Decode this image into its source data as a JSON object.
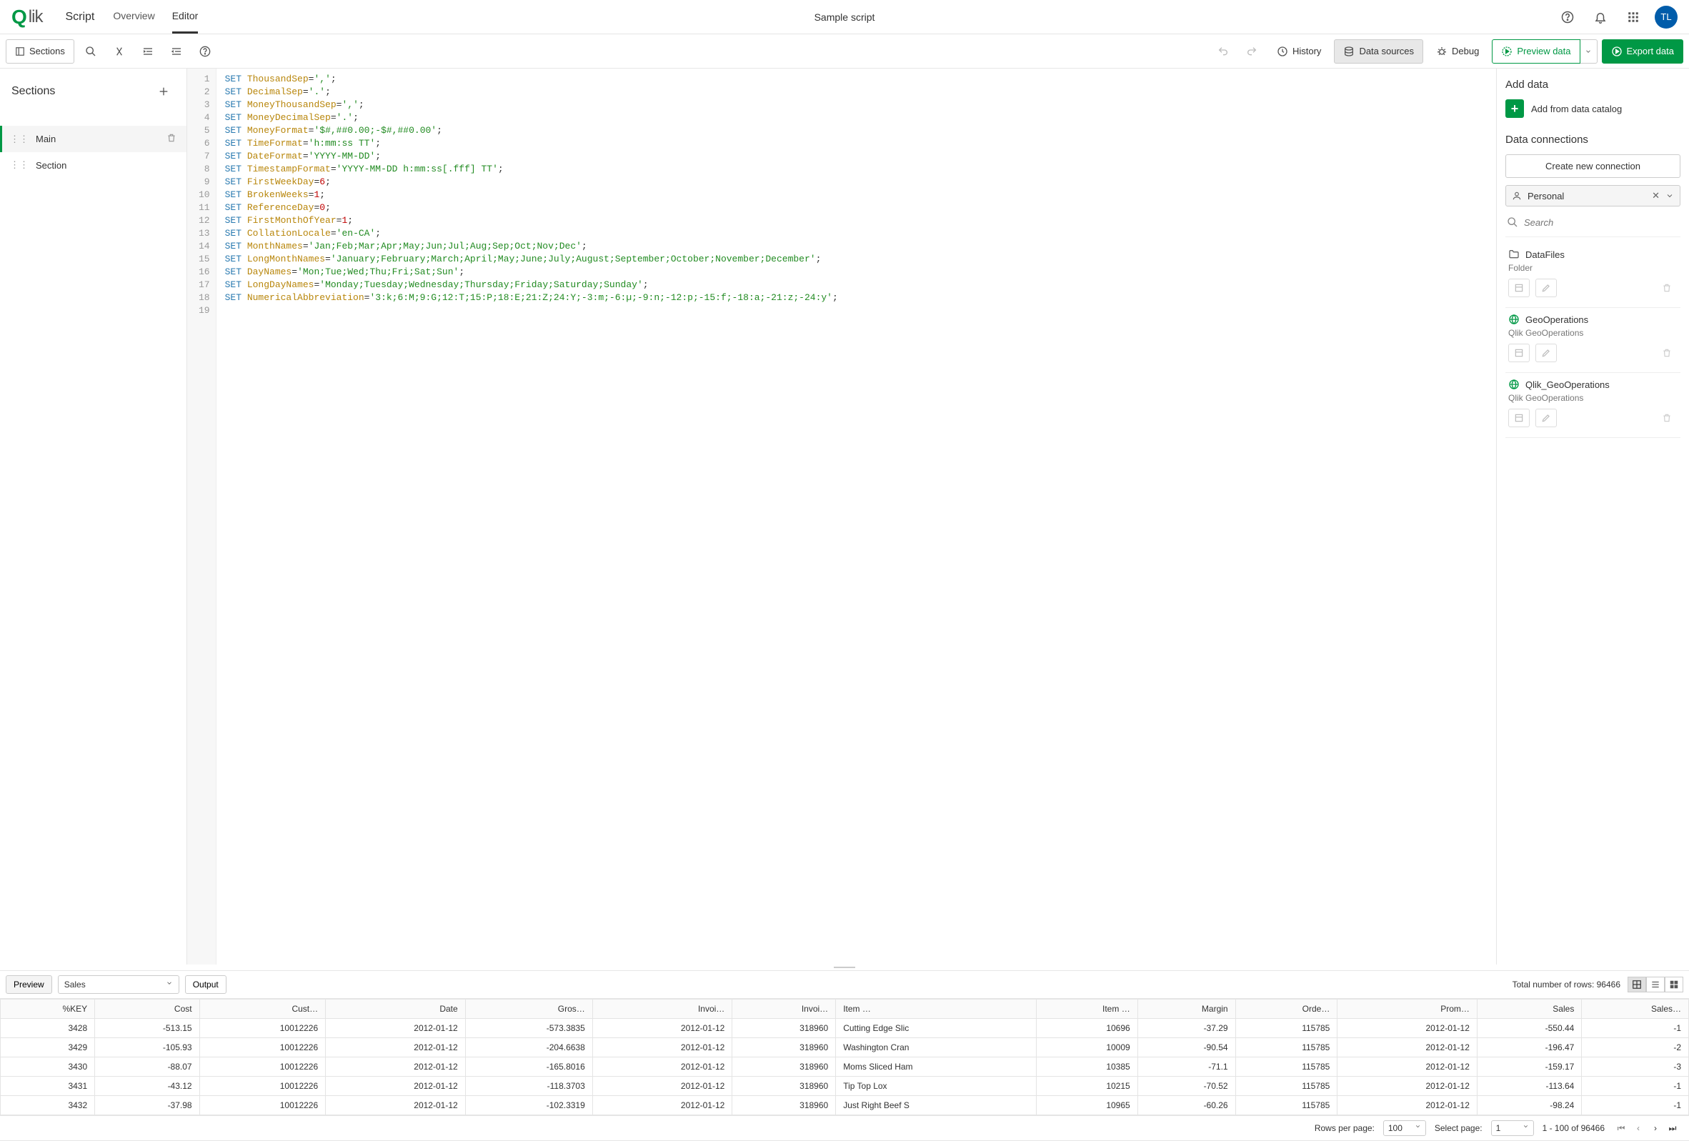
{
  "header": {
    "logo_text": "lik",
    "script_label": "Script",
    "tabs": [
      {
        "label": "Overview",
        "key": "overview"
      },
      {
        "label": "Editor",
        "key": "editor",
        "active": true
      }
    ],
    "title": "Sample script",
    "avatar": "TL"
  },
  "toolbar": {
    "sections": "Sections",
    "history": "History",
    "datasources": "Data sources",
    "debug": "Debug",
    "preview": "Preview data",
    "export": "Export data"
  },
  "sections": {
    "heading": "Sections",
    "items": [
      {
        "label": "Main",
        "active": true,
        "has_delete": true
      },
      {
        "label": "Section",
        "active": false,
        "has_delete": false
      }
    ]
  },
  "code": {
    "lines": [
      {
        "kw": "SET",
        "id": "ThousandSep",
        "rest": "=",
        "lit": "','",
        "tail": ";"
      },
      {
        "kw": "SET",
        "id": "DecimalSep",
        "rest": "=",
        "lit": "'.'",
        "tail": ";"
      },
      {
        "kw": "SET",
        "id": "MoneyThousandSep",
        "rest": "=",
        "lit": "','",
        "tail": ";"
      },
      {
        "kw": "SET",
        "id": "MoneyDecimalSep",
        "rest": "=",
        "lit": "'.'",
        "tail": ";"
      },
      {
        "kw": "SET",
        "id": "MoneyFormat",
        "rest": "=",
        "lit": "'$#,##0.00;-$#,##0.00'",
        "tail": ";"
      },
      {
        "kw": "SET",
        "id": "TimeFormat",
        "rest": "=",
        "lit": "'h:mm:ss TT'",
        "tail": ";"
      },
      {
        "kw": "SET",
        "id": "DateFormat",
        "rest": "=",
        "lit": "'YYYY-MM-DD'",
        "tail": ";"
      },
      {
        "kw": "SET",
        "id": "TimestampFormat",
        "rest": "=",
        "lit": "'YYYY-MM-DD h:mm:ss[.fff] TT'",
        "tail": ";"
      },
      {
        "kw": "SET",
        "id": "FirstWeekDay",
        "rest": "=",
        "num": "6",
        "tail": ";"
      },
      {
        "kw": "SET",
        "id": "BrokenWeeks",
        "rest": "=",
        "num": "1",
        "tail": ";"
      },
      {
        "kw": "SET",
        "id": "ReferenceDay",
        "rest": "=",
        "num": "0",
        "tail": ";"
      },
      {
        "kw": "SET",
        "id": "FirstMonthOfYear",
        "rest": "=",
        "num": "1",
        "tail": ";"
      },
      {
        "kw": "SET",
        "id": "CollationLocale",
        "rest": "=",
        "lit": "'en-CA'",
        "tail": ";"
      },
      {
        "kw": "SET",
        "id": "MonthNames",
        "rest": "=",
        "lit": "'Jan;Feb;Mar;Apr;May;Jun;Jul;Aug;Sep;Oct;Nov;Dec'",
        "tail": ";"
      },
      {
        "kw": "SET",
        "id": "LongMonthNames",
        "rest": "=",
        "lit": "'January;February;March;April;May;June;July;August;September;October;November;December'",
        "tail": ";"
      },
      {
        "kw": "SET",
        "id": "DayNames",
        "rest": "=",
        "lit": "'Mon;Tue;Wed;Thu;Fri;Sat;Sun'",
        "tail": ";"
      },
      {
        "kw": "SET",
        "id": "LongDayNames",
        "rest": "=",
        "lit": "'Monday;Tuesday;Wednesday;Thursday;Friday;Saturday;Sunday'",
        "tail": ";"
      },
      {
        "kw": "SET",
        "id": "NumericalAbbreviation",
        "rest": "=",
        "lit": "'3:k;6:M;9:G;12:T;15:P;18:E;21:Z;24:Y;-3:m;-6:µ;-9:n;-12:p;-15:f;-18:a;-21:z;-24:y'",
        "tail": ";"
      },
      {
        "blank": true
      }
    ]
  },
  "right": {
    "add_heading": "Add data",
    "add_catalog": "Add from data catalog",
    "conn_heading": "Data connections",
    "create_conn": "Create new connection",
    "space": "Personal",
    "search_placeholder": "Search",
    "connections": [
      {
        "name": "DataFiles",
        "sub": "Folder",
        "icon": "folder"
      },
      {
        "name": "GeoOperations",
        "sub": "Qlik GeoOperations",
        "icon": "globe"
      },
      {
        "name": "Qlik_GeoOperations",
        "sub": "Qlik GeoOperations",
        "icon": "globe"
      }
    ]
  },
  "preview": {
    "tab": "Preview",
    "select": "Sales",
    "output": "Output",
    "total_label": "Total number of rows: ",
    "total_value": "96466",
    "columns": [
      "%KEY",
      "Cost",
      "Cust…",
      "Date",
      "Gros…",
      "Invoi…",
      "Invoi…",
      "Item …",
      "Item …",
      "Margin",
      "Orde…",
      "Prom…",
      "Sales",
      "Sales…"
    ],
    "rows": [
      [
        "3428",
        "-513.15",
        "10012226",
        "2012-01-12",
        "-573.3835",
        "2012-01-12",
        "318960",
        "Cutting Edge Slic",
        "10696",
        "-37.29",
        "115785",
        "2012-01-12",
        "-550.44",
        "-1"
      ],
      [
        "3429",
        "-105.93",
        "10012226",
        "2012-01-12",
        "-204.6638",
        "2012-01-12",
        "318960",
        "Washington Cran",
        "10009",
        "-90.54",
        "115785",
        "2012-01-12",
        "-196.47",
        "-2"
      ],
      [
        "3430",
        "-88.07",
        "10012226",
        "2012-01-12",
        "-165.8016",
        "2012-01-12",
        "318960",
        "Moms Sliced Ham",
        "10385",
        "-71.1",
        "115785",
        "2012-01-12",
        "-159.17",
        "-3"
      ],
      [
        "3431",
        "-43.12",
        "10012226",
        "2012-01-12",
        "-118.3703",
        "2012-01-12",
        "318960",
        "Tip Top Lox",
        "10215",
        "-70.52",
        "115785",
        "2012-01-12",
        "-113.64",
        "-1"
      ],
      [
        "3432",
        "-37.98",
        "10012226",
        "2012-01-12",
        "-102.3319",
        "2012-01-12",
        "318960",
        "Just Right Beef S",
        "10965",
        "-60.26",
        "115785",
        "2012-01-12",
        "-98.24",
        "-1"
      ]
    ]
  },
  "pager": {
    "rows_label": "Rows per page:",
    "rows_value": "100",
    "page_label": "Select page:",
    "page_value": "1",
    "range": "1 - 100 of 96466"
  }
}
